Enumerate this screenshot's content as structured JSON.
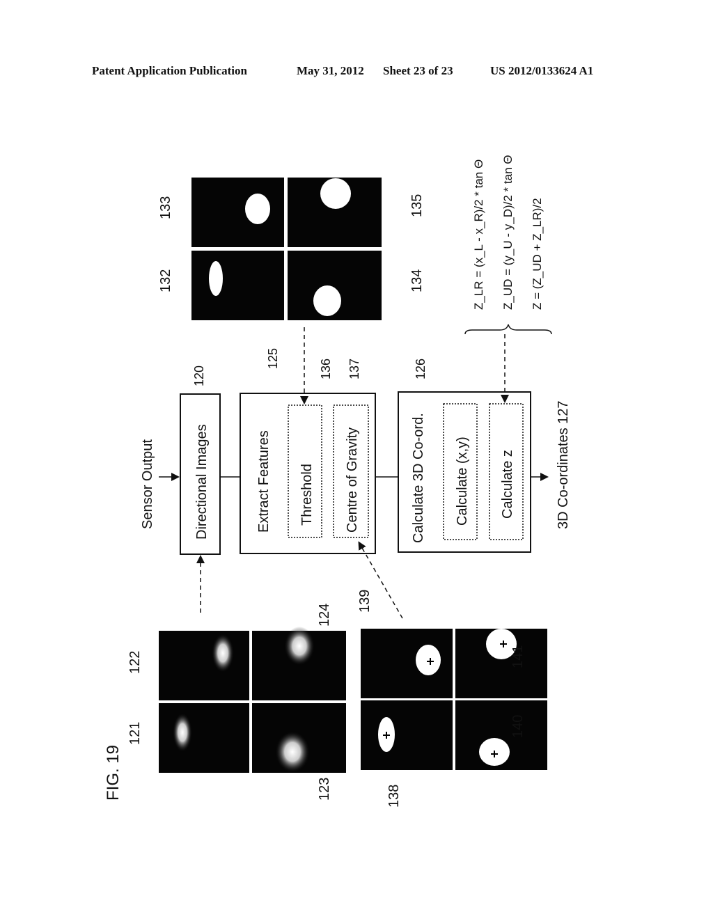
{
  "header": {
    "left": "Patent Application Publication",
    "date": "May 31, 2012",
    "sheet": "Sheet 23 of 23",
    "number": "US 2012/0133624 A1"
  },
  "figure": {
    "title": "FIG. 19",
    "sensor_output": "Sensor Output",
    "directional_images": {
      "label": "Directional Images",
      "ref": "120"
    },
    "extract_features": {
      "label": "Extract Features",
      "ref": "125",
      "threshold": {
        "label": "Threshold",
        "ref": "136"
      },
      "centre_of_gravity": {
        "label": "Centre of Gravity",
        "ref": "137"
      }
    },
    "calculate_3d": {
      "label": "Calculate 3D Co-ord.",
      "ref": "126",
      "calc_xy": "Calculate (x,y)",
      "calc_z": "Calculate z"
    },
    "output": "3D Co-ordinates 127",
    "raw_images": [
      "121",
      "122",
      "123",
      "124"
    ],
    "threshold_images": [
      "132",
      "133",
      "134",
      "135"
    ],
    "cog_images": [
      "138",
      "139",
      "140",
      "141"
    ],
    "equations": [
      "Z_LR = (x_L - x_R)/2 * tan Θ",
      "Z_UD = (y_U - y_D)/2 * tan Θ",
      "Z = (Z_UD + Z_LR)/2"
    ]
  }
}
